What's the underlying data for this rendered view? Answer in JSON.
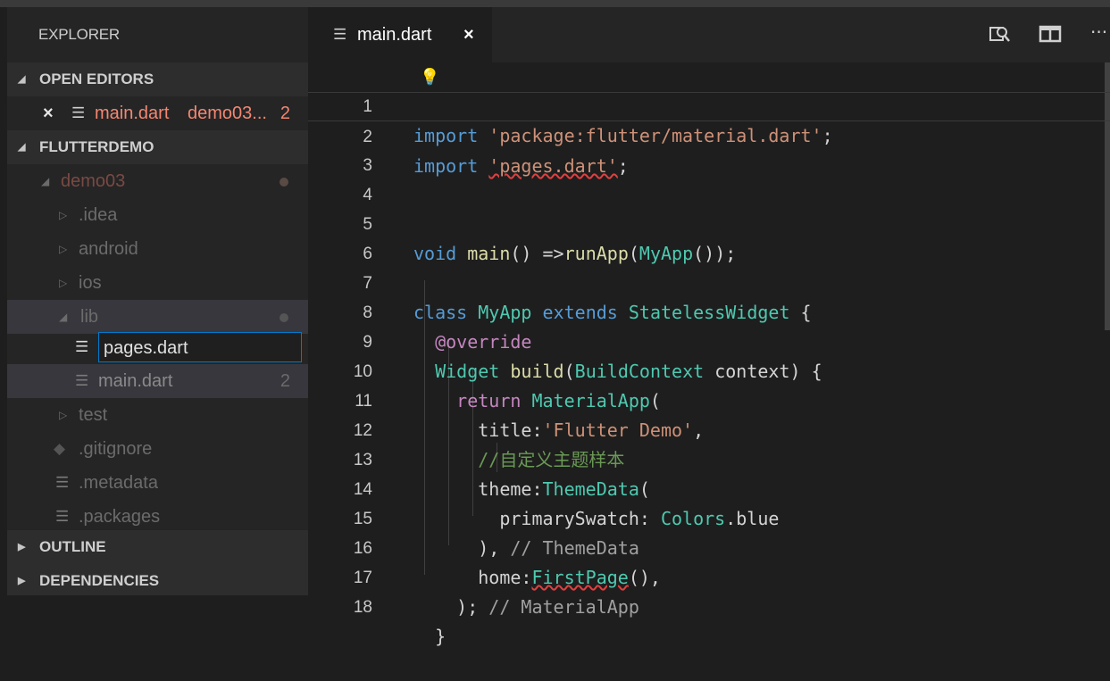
{
  "sidebar": {
    "title": "EXPLORER",
    "open_editors": {
      "label": "OPEN EDITORS",
      "item": {
        "close_icon": "×",
        "name": "main.dart",
        "folder": "demo03...",
        "badge": "2"
      }
    },
    "project": {
      "label": "FLUTTERDEMO",
      "root": "demo03",
      "items": [
        ".idea",
        "android",
        "ios",
        "lib",
        "pages.dart",
        "main.dart",
        "test",
        ".gitignore",
        ".metadata",
        ".packages"
      ],
      "main_badge": "2"
    },
    "outline_label": "OUTLINE",
    "dependencies_label": "DEPENDENCIES"
  },
  "tab": {
    "name": "main.dart",
    "close": "×"
  },
  "actions": {
    "search_icon": "open-changes-icon",
    "split_icon": "split-editor-icon",
    "more": "···"
  },
  "editor": {
    "line_numbers": [
      "1",
      "2",
      "3",
      "4",
      "5",
      "6",
      "7",
      "8",
      "9",
      "10",
      "11",
      "12",
      "13",
      "14",
      "15",
      "16",
      "17",
      "18"
    ],
    "lines": [
      "import 'package:flutter/material.dart';",
      "import 'pages.dart';",
      "",
      "",
      "void main() =>runApp(MyApp());",
      "",
      "class MyApp extends StatelessWidget {",
      "  @override",
      "  Widget build(BuildContext context) {",
      "    return MaterialApp(",
      "      title:'Flutter Demo',",
      "      //自定义主题样本",
      "      theme:ThemeData(",
      "        primarySwatch: Colors.blue",
      "      ), // ThemeData",
      "      home:FirstPage(),",
      "    ); // MaterialApp",
      "  }"
    ]
  }
}
